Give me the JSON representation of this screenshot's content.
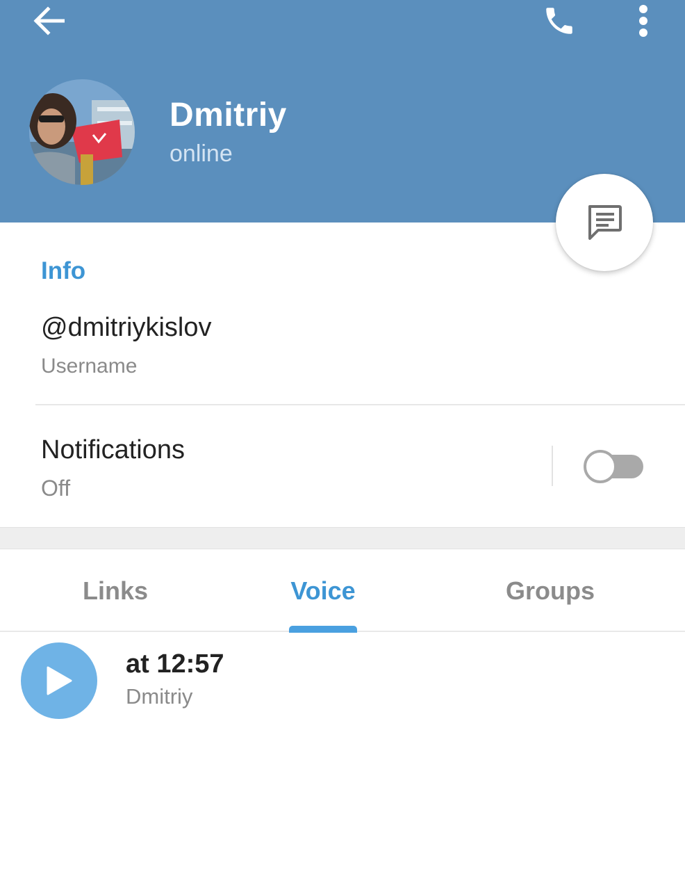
{
  "header": {
    "name": "Dmitriy",
    "status": "online",
    "back_icon": "arrow-left-icon",
    "call_icon": "phone-icon",
    "menu_icon": "more-vertical-icon",
    "background_color": "#5b8fbd"
  },
  "fab": {
    "icon": "message-icon"
  },
  "info": {
    "section_title": "Info",
    "username": "@dmitriykislov",
    "username_label": "Username",
    "notifications_title": "Notifications",
    "notifications_value": "Off",
    "notifications_enabled": false
  },
  "tabs": [
    {
      "label": "Links",
      "active": false
    },
    {
      "label": "Voice",
      "active": true
    },
    {
      "label": "Groups",
      "active": false
    }
  ],
  "voice_items": [
    {
      "time": "at 12:57",
      "author": "Dmitriy",
      "icon": "play-icon"
    }
  ],
  "colors": {
    "accent": "#3d95d4",
    "play_button": "#6fb3e6",
    "secondary_text": "#8a8a8a"
  }
}
